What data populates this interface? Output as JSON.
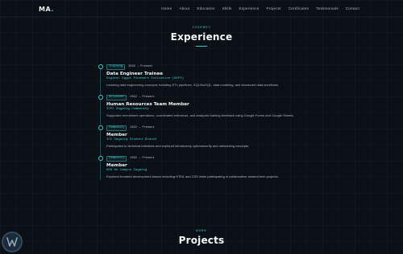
{
  "nav": {
    "logo": "MA",
    "logo_dot": ".",
    "links": [
      "Home",
      "About",
      "Education",
      "Skills",
      "Experience",
      "Projects",
      "Certificates",
      "Testimonials",
      "Contact"
    ]
  },
  "experience": {
    "eyebrow": "JOURNEY",
    "title": "Experience",
    "items": [
      {
        "badge": "Training",
        "date": "2025 – Present",
        "role": "Data Engineer Trainee",
        "org": "Digital Egypt Pioneers Initiative (DEPI)",
        "desc": "Learning data engineering concepts including ETL pipelines, SQL/NoSQL, data modeling, and structured data workflows."
      },
      {
        "badge": "Volunteer",
        "date": "2022 – Present",
        "role": "Human Resources Team Member",
        "org": "ICPC Zagazig Community",
        "desc": "Supported recruitment operations, coordinated interviews, and analyzed training feedback using Google Forms and Google Sheets."
      },
      {
        "badge": "Community",
        "date": "2022 – Present",
        "role": "Member",
        "org": "ICC Zagazig Student Branch",
        "desc": "Participated in technical initiatives and explored introductory cybersecurity and networking concepts."
      },
      {
        "badge": "Community",
        "date": "2022 – Present",
        "role": "Member",
        "org": "GDG On Campus Zagazig",
        "desc": "Explored frontend development basics including HTML and CSS while participating in collaborative student tech projects."
      }
    ]
  },
  "projects": {
    "eyebrow": "WORK",
    "title": "Projects"
  },
  "colors": {
    "background": "#0b1016",
    "accent": "#3ccfcf",
    "text": "#e8eef2",
    "muted": "#aab6c2"
  },
  "icons": {
    "corner": "w-logo-icon"
  }
}
